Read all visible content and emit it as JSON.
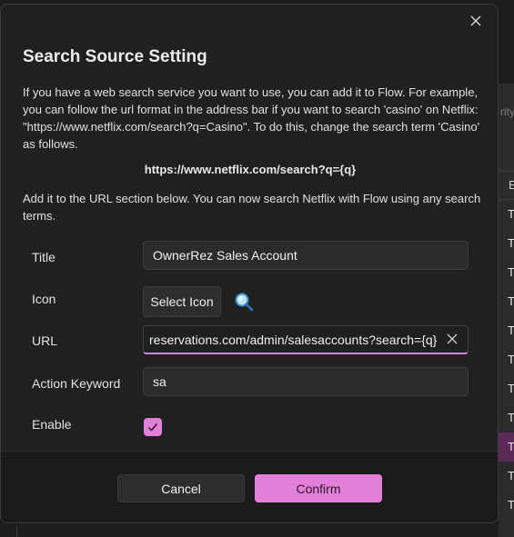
{
  "background": {
    "partial_text": "rity",
    "header_text": "E",
    "row_char": "T",
    "colors": {
      "selected_row": "#5b2a57"
    }
  },
  "dialog": {
    "title": "Search Source Setting",
    "description": "If you have a web search service you want to use, you can add it to Flow. For example, you can follow the url format in the address bar if you want to search 'casino' on Netflix: \"https://www.netflix.com/search?q=Casino\". To do this, change the search term 'Casino' as follows.",
    "example_url": "https://www.netflix.com/search?q={q}",
    "description2": "Add it to the URL section below. You can now search Netflix with Flow using any search terms.",
    "fields": {
      "title_label": "Title",
      "title_value": "OwnerRez Sales Account",
      "icon_label": "Icon",
      "select_icon_label": "Select Icon",
      "url_label": "URL",
      "url_value": "reservations.com/admin/salesaccounts?search={q}",
      "action_keyword_label": "Action Keyword",
      "action_keyword_value": "sa",
      "enable_label": "Enable",
      "enable_checked": true
    },
    "buttons": {
      "cancel": "Cancel",
      "confirm": "Confirm"
    },
    "icons": {
      "close": "close-icon",
      "clear": "clear-icon",
      "search_preview": "search-icon",
      "check": "checkmark-icon"
    },
    "colors": {
      "accent": "#e27fd8",
      "background": "#202020",
      "footer": "#1b1b1b"
    }
  }
}
